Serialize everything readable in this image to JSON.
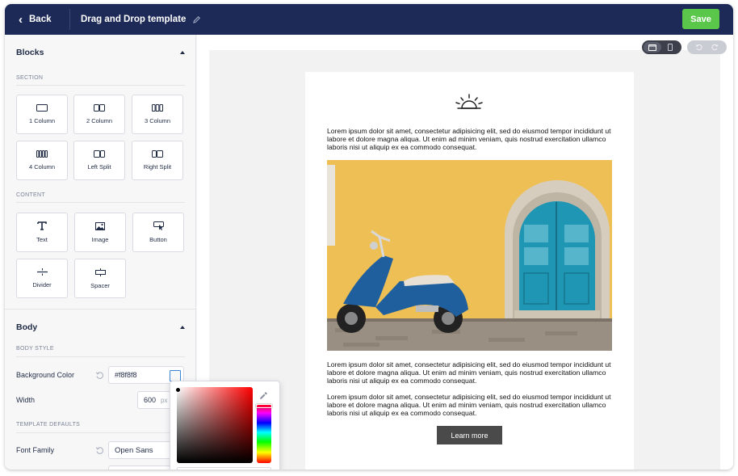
{
  "topbar": {
    "back_label": "Back",
    "title": "Drag and Drop template",
    "save_label": "Save"
  },
  "sidebar": {
    "blocks_heading": "Blocks",
    "section_label": "SECTION",
    "section_items": [
      {
        "label": "1 Column",
        "icon": "one-column-icon"
      },
      {
        "label": "2 Column",
        "icon": "two-column-icon"
      },
      {
        "label": "3 Column",
        "icon": "three-column-icon"
      },
      {
        "label": "4 Column",
        "icon": "four-column-icon"
      },
      {
        "label": "Left Split",
        "icon": "left-split-icon"
      },
      {
        "label": "Right Split",
        "icon": "right-split-icon"
      }
    ],
    "content_label": "CONTENT",
    "content_items": [
      {
        "label": "Text",
        "icon": "text-icon"
      },
      {
        "label": "Image",
        "icon": "image-icon"
      },
      {
        "label": "Button",
        "icon": "button-icon"
      },
      {
        "label": "Divider",
        "icon": "divider-icon"
      },
      {
        "label": "Spacer",
        "icon": "spacer-icon"
      }
    ],
    "body_heading": "Body",
    "body_style_label": "BODY STYLE",
    "background_color_label": "Background Color",
    "background_color_value": "#f8f8f8",
    "width_label": "Width",
    "width_value": "600",
    "width_unit": "px",
    "template_defaults_label": "TEMPLATE DEFAULTS",
    "font_family_label": "Font Family",
    "font_family_value": "Open Sans"
  },
  "email": {
    "paragraph_1": "Lorem ipsum dolor sit amet, consectetur adipisicing elit, sed do eiusmod tempor incididunt ut labore et dolore magna aliqua. Ut enim ad minim veniam, quis nostrud exercitation ullamco laboris nisi ut aliquip ex ea commodo consequat.",
    "paragraph_2": "Lorem ipsum dolor sit amet, consectetur adipisicing elit, sed do eiusmod tempor incididunt ut labore et dolore magna aliqua. Ut enim ad minim veniam, quis nostrud exercitation ullamco laboris nisi ut aliquip ex ea commodo consequat.",
    "paragraph_3": "Lorem ipsum dolor sit amet, consectetur adipisicing elit, sed do eiusmod tempor incididunt ut labore et dolore magna aliqua. Ut enim ad minim veniam, quis nostrud exercitation ullamco laboris nisi ut aliquip ex ea commodo consequat.",
    "cta_label": "Learn more"
  },
  "colors": {
    "topbar": "#1d2a57",
    "save": "#5bc74a",
    "cta": "#4a4a4a",
    "wall": "#f2c254",
    "door": "#1e96b4",
    "scooter": "#1f5f9e"
  }
}
